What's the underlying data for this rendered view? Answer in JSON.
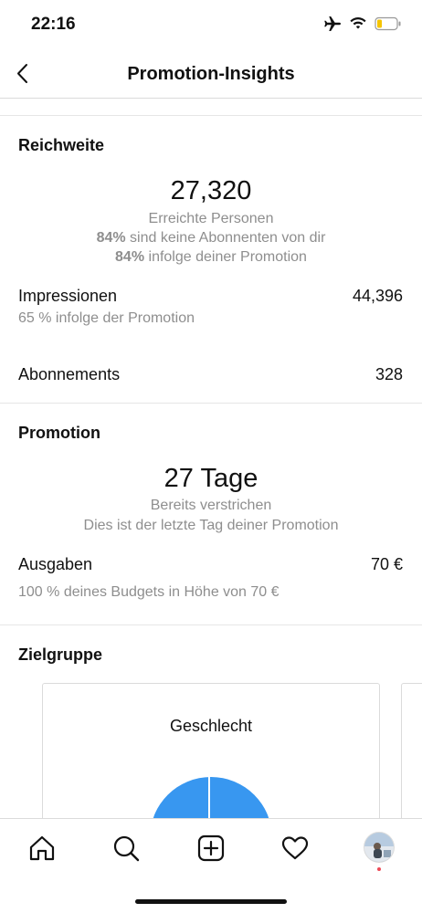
{
  "status": {
    "time": "22:16"
  },
  "header": {
    "title": "Promotion-Insights"
  },
  "reach": {
    "title": "Reichweite",
    "number": "27,320",
    "subtitle": "Erreichte Personen",
    "line1_bold": "84%",
    "line1_rest": " sind keine Abonnenten von dir",
    "line2_bold": "84%",
    "line2_rest": " infolge deiner Promotion",
    "impressions_label": "Impressionen",
    "impressions_value": "44,396",
    "impressions_sub": "65 % infolge der Promotion",
    "follows_label": "Abonnements",
    "follows_value": "328"
  },
  "promotion": {
    "title": "Promotion",
    "duration": "27 Tage",
    "elapsed": "Bereits verstrichen",
    "last_day": "Dies ist der letzte Tag deiner Promotion",
    "spend_label": "Ausgaben",
    "spend_value": "70 €",
    "spend_sub": "100 % deines Budgets in Höhe von 70 €"
  },
  "audience": {
    "title": "Zielgruppe",
    "card_title": "Geschlecht",
    "pie_color": "#3897f0"
  },
  "tabs": [
    "home-icon",
    "search-icon",
    "new-post-icon",
    "activity-icon",
    "profile-avatar"
  ],
  "colors": {
    "text": "#262626",
    "secondary": "#8e8e8e",
    "divider": "#dbdbdb",
    "accent": "#3897f0",
    "badge": "#ed4956"
  }
}
